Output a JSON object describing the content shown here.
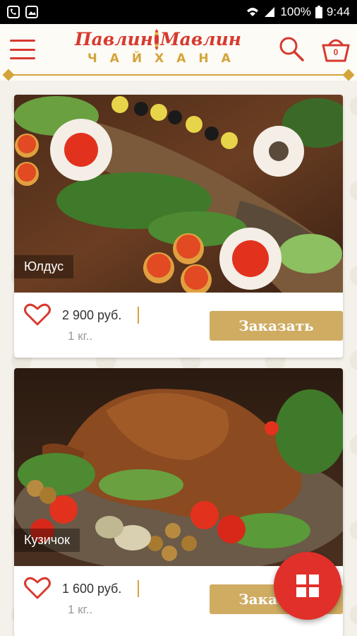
{
  "status_bar": {
    "battery": "100%",
    "time": "9:44"
  },
  "header": {
    "logo_main_left": "Павлин",
    "logo_main_right": "Мавлин",
    "logo_sub": "ЧАЙХАНА",
    "cart_count": "0"
  },
  "products": [
    {
      "title": "Юлдус",
      "price": "2 900 руб.",
      "weight": "1 кг..",
      "order_label": "Заказать"
    },
    {
      "title": "Кузичок",
      "price": "1 600 руб.",
      "weight": "1 кг..",
      "order_label": "Заказать"
    }
  ],
  "colors": {
    "brand_red": "#d63a2f",
    "brand_gold": "#d4a43a",
    "button_gold": "#cfac62",
    "fab_red": "#e1302a"
  }
}
